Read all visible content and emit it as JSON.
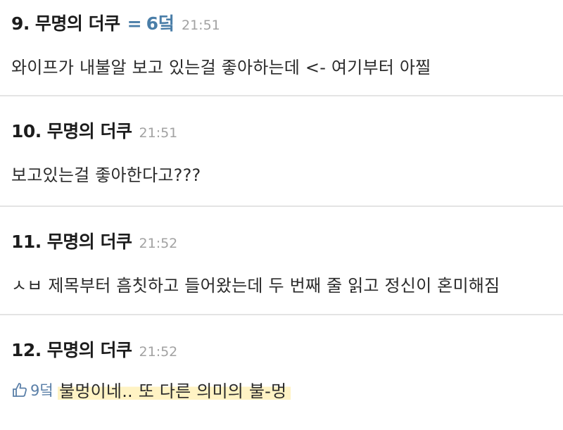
{
  "comments": [
    {
      "number": "9.",
      "author": "무명의 더쿠",
      "award_prefix": "=",
      "award": "6덬",
      "time": "21:51",
      "text": "와이프가 내불알 보고 있는걸 좋아하는데 <- 여기부터 아찔"
    },
    {
      "number": "10.",
      "author": "무명의 더쿠",
      "time": "21:51",
      "text": "보고있는걸 좋아한다고???"
    },
    {
      "number": "11.",
      "author": "무명의 더쿠",
      "time": "21:52",
      "text": "ㅅㅂ 제목부터 흠칫하고 들어왔는데 두 번째 줄 읽고 정신이 혼미해짐"
    },
    {
      "number": "12.",
      "author": "무명의 더쿠",
      "time": "21:52",
      "reply_to": "9덬",
      "reply_icon": "thumb-up-icon",
      "text": "불멍이네.. 또 다른 의미의 불-멍"
    }
  ],
  "colors": {
    "reply_ref": "#5a7fa8",
    "award": "#4a7ea8",
    "timestamp": "#a2a2a2",
    "highlight": "#fff3c4",
    "divider": "#e4e4e4"
  }
}
